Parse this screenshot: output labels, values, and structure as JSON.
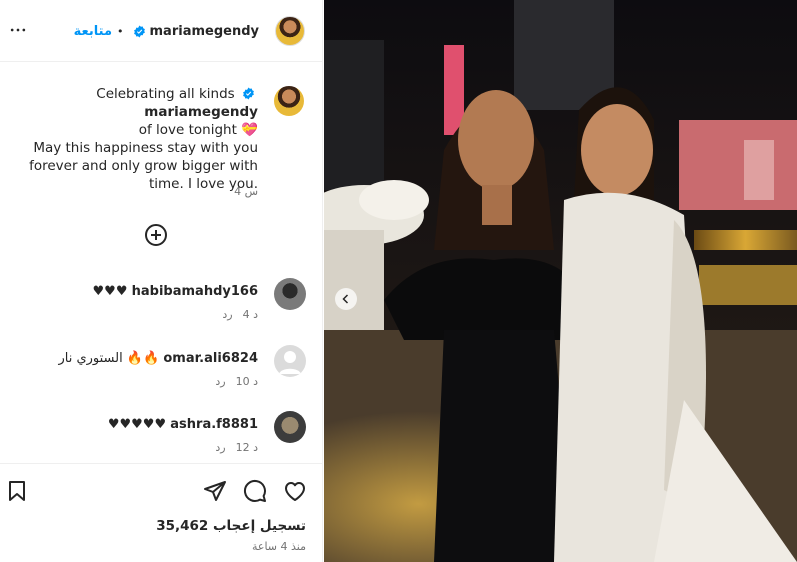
{
  "header": {
    "username": "mariamegendy",
    "follow_label": "متابعة",
    "separator": "•"
  },
  "caption": {
    "username": "mariamegendy",
    "line1": "Celebrating all kinds",
    "line2": "of love tonight 💝",
    "line3": "May this happiness stay with you",
    "line4": "forever and only grow bigger with",
    "line5": "time. I love you.",
    "time": "4 س"
  },
  "comments": [
    {
      "username": "habibamahdy166",
      "text": "♥♥♥",
      "time": "4 د",
      "reply_label": "رد"
    },
    {
      "username": "omar.ali6824",
      "text": "الستوري نار 🔥🔥",
      "time": "10 د",
      "reply_label": "رد"
    },
    {
      "username": "ashra.f8881",
      "text": "♥♥♥♥♥",
      "time": "12 د",
      "reply_label": "رد"
    }
  ],
  "actions": {
    "likes": "35,462 تسجيل إعجاب",
    "time_ago": "منذ 4 ساعة"
  },
  "icons": {
    "more": "more-horizontal-icon",
    "verified": "verified-badge-icon",
    "add": "add-circle-icon",
    "bookmark": "bookmark-icon",
    "share": "send-icon",
    "comment": "comment-icon",
    "like": "heart-icon",
    "prev": "chevron-left-icon"
  },
  "colors": {
    "accent": "#0095f6",
    "text": "#262626",
    "muted": "#737373"
  }
}
